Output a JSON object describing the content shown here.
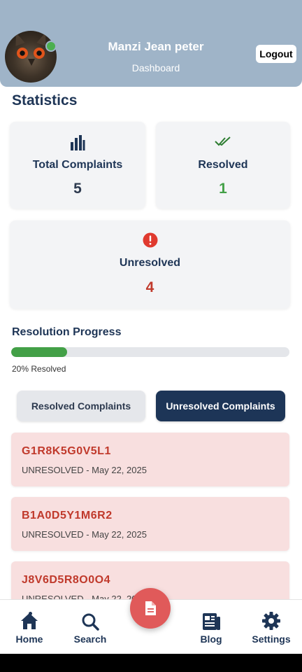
{
  "header": {
    "user_name": "Manzi Jean peter",
    "role": "Dashboard",
    "logout_label": "Logout",
    "online_status_color": "#4caf50"
  },
  "statistics": {
    "title": "Statistics",
    "cards": [
      {
        "label": "Total Complaints",
        "value": "5",
        "icon": "bar-chart-icon",
        "value_color": "#1e3556"
      },
      {
        "label": "Resolved",
        "value": "1",
        "icon": "double-check-icon",
        "value_color": "#43a047"
      },
      {
        "label": "Unresolved",
        "value": "4",
        "icon": "exclamation-circle-icon",
        "value_color": "#c0392b"
      }
    ]
  },
  "progress": {
    "title": "Resolution Progress",
    "percent": 20,
    "text": "20% Resolved",
    "fill_color": "#43a047"
  },
  "tabs": {
    "resolved_label": "Resolved Complaints",
    "unresolved_label": "Unresolved Complaints",
    "active": "unresolved"
  },
  "complaints": [
    {
      "id": "G1R8K5G0V5L1",
      "meta": "UNRESOLVED - May 22, 2025"
    },
    {
      "id": "B1A0D5Y1M6R2",
      "meta": "UNRESOLVED - May 22, 2025"
    },
    {
      "id": "J8V6D5R8O0O4",
      "meta": "UNRESOLVED - May 22, 2025"
    }
  ],
  "bottom_nav": {
    "items": [
      {
        "label": "Home",
        "icon": "home-icon",
        "active": true
      },
      {
        "label": "Search",
        "icon": "search-icon"
      },
      {
        "label": "Blog",
        "icon": "newspaper-icon"
      },
      {
        "label": "Settings",
        "icon": "gear-icon"
      }
    ],
    "fab_icon": "document-icon"
  },
  "colors": {
    "header_bg": "#9fb4c8",
    "primary": "#1e3556",
    "danger": "#c0392b",
    "complaint_bg": "#f8dfdf",
    "fab_bg": "#e05a5a"
  }
}
